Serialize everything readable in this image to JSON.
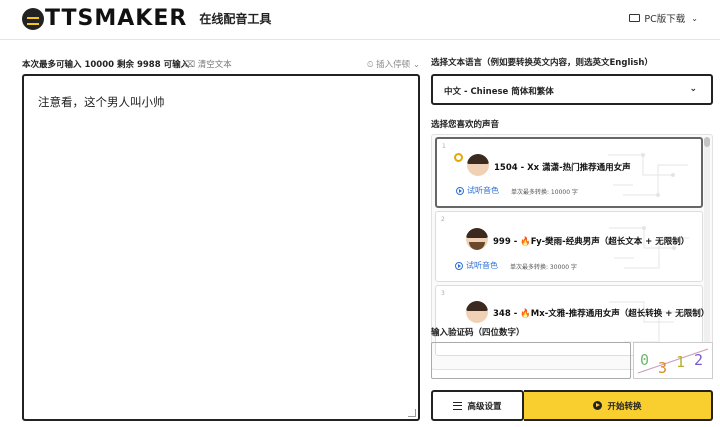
{
  "header": {
    "logo_text": "TTSMAKER",
    "logo_sub": "在线配音工具",
    "pc_download": "PC版下载"
  },
  "editor": {
    "count_text": "本次最多可输入 10000 剩余 9988 可输入",
    "clear_label": "清空文本",
    "insert_pause_label": "插入停顿",
    "content": "注意看，这个男人叫小帅"
  },
  "language": {
    "label": "选择文本语言（例如要转换英文内容，则选英文English）",
    "selected": "中文 - Chinese 简体和繁体"
  },
  "voices": {
    "label": "选择您喜欢的声音",
    "items": [
      {
        "index": "1",
        "name": "1504 - Xx 潇潇-热门推荐通用女声",
        "preview": "试听音色",
        "limit": "单次最多转换: 10000 字",
        "selected": true
      },
      {
        "index": "2",
        "name": "999 - 🔥Fy-樊雨-经典男声（超长文本 + 无限制）",
        "preview": "试听音色",
        "limit": "单次最多转换: 30000 字",
        "selected": false
      },
      {
        "index": "3",
        "name": "348 - 🔥Mx-文雅-推荐通用女声（超长转换 + 无限制）",
        "preview": "",
        "limit": "",
        "selected": false
      }
    ]
  },
  "captcha": {
    "label": "输入验证码（四位数字）",
    "value": "",
    "code": "0312"
  },
  "actions": {
    "advanced": "高级设置",
    "start": "开始转换"
  },
  "colors": {
    "accent_yellow": "#f9cf2f",
    "link_blue": "#2b6fd6"
  }
}
